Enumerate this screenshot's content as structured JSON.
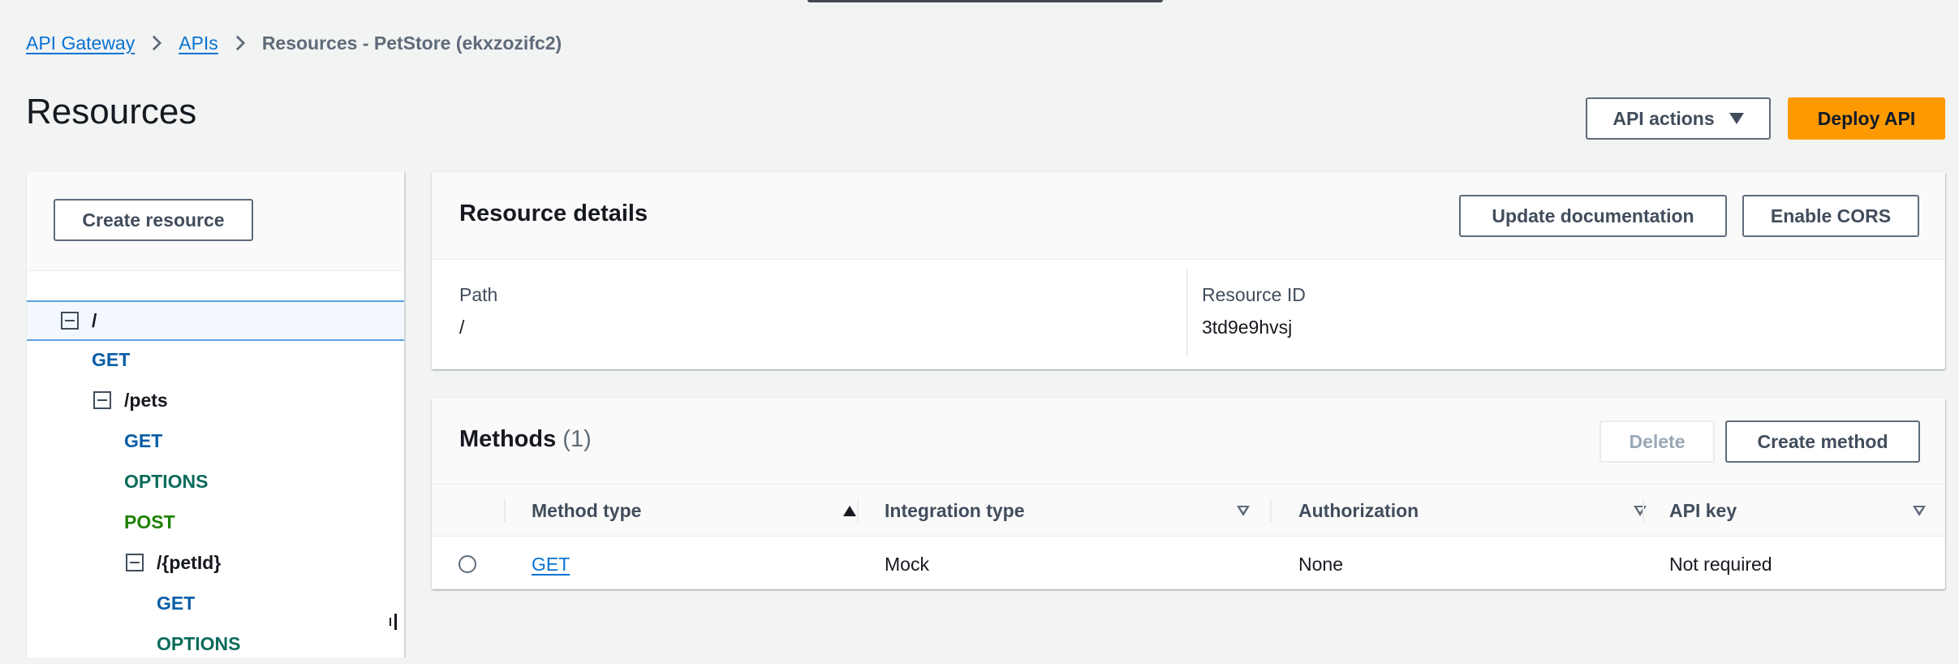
{
  "breadcrumb": {
    "items": [
      "API Gateway",
      "APIs"
    ],
    "current": "Resources - PetStore (ekxzozifc2)"
  },
  "page": {
    "title": "Resources",
    "api_actions_label": "API actions",
    "deploy_label": "Deploy API"
  },
  "tree": {
    "create_resource_label": "Create resource",
    "nodes": [
      {
        "label": "/",
        "kind": "resource"
      },
      {
        "label": "GET",
        "kind": "method"
      },
      {
        "label": "/pets",
        "kind": "resource"
      },
      {
        "label": "GET",
        "kind": "method"
      },
      {
        "label": "OPTIONS",
        "kind": "method"
      },
      {
        "label": "POST",
        "kind": "method"
      },
      {
        "label": "/{petId}",
        "kind": "resource"
      },
      {
        "label": "GET",
        "kind": "method"
      },
      {
        "label": "OPTIONS",
        "kind": "method"
      }
    ]
  },
  "resource_details": {
    "title": "Resource details",
    "update_doc_label": "Update documentation",
    "enable_cors_label": "Enable CORS",
    "path_label": "Path",
    "path_value": "/",
    "resource_id_label": "Resource ID",
    "resource_id_value": "3td9e9hvsj"
  },
  "methods": {
    "title": "Methods",
    "count": "(1)",
    "delete_label": "Delete",
    "create_label": "Create method",
    "columns": [
      "Method type",
      "Integration type",
      "Authorization",
      "API key"
    ],
    "rows": [
      {
        "method_type": "GET",
        "integration_type": "Mock",
        "authorization": "None",
        "api_key": "Not required"
      }
    ]
  },
  "colors": {
    "accent": "#0972d3",
    "primary_button": "#ff9900",
    "get_method": "#0a5da6",
    "options_method": "#0b6b5b",
    "post_method": "#1d8102"
  }
}
